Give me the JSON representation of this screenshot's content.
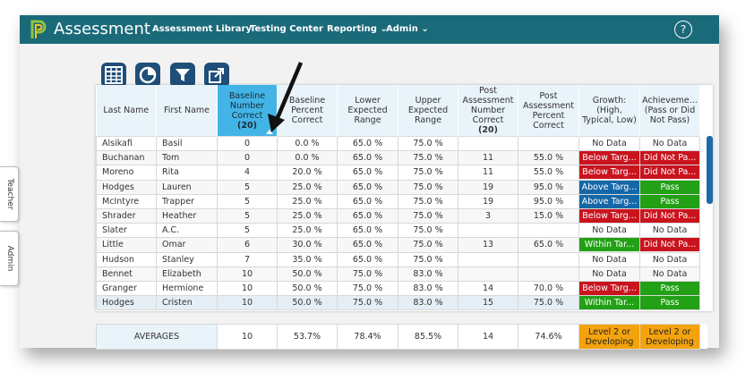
{
  "app": {
    "title": "Assessment",
    "nav": [
      {
        "label": "Assessment Library",
        "dropdown": false
      },
      {
        "label": "Testing Center",
        "dropdown": false
      },
      {
        "label": "Reporting",
        "dropdown": true
      },
      {
        "label": "Admin",
        "dropdown": true
      }
    ],
    "help_label": "?",
    "brand_color": "#1a6a7a"
  },
  "toolbar": {
    "icons": [
      "table-view-icon",
      "chart-view-icon",
      "filter-icon",
      "export-icon"
    ]
  },
  "side_tabs": [
    {
      "label": "Teacher"
    },
    {
      "label": "Admin"
    }
  ],
  "table": {
    "headers": [
      {
        "label": "Last Name",
        "count": ""
      },
      {
        "label": "First Name",
        "count": ""
      },
      {
        "label": "Baseline Number Correct",
        "count": "(20)",
        "selected": true
      },
      {
        "label": "Baseline Percent Correct",
        "count": ""
      },
      {
        "label": "Lower Expected Range",
        "count": ""
      },
      {
        "label": "Upper Expected Range",
        "count": ""
      },
      {
        "label": "Post Assessment Number Correct",
        "count": "(20)"
      },
      {
        "label": "Post Assessment Percent Correct",
        "count": ""
      },
      {
        "label": "Growth: (High, Typical, Low)",
        "count": ""
      },
      {
        "label": "Achieveme... (Pass or Did Not Pass)",
        "count": ""
      }
    ],
    "rows": [
      {
        "last": "Alsikafi",
        "first": "Basil",
        "bnc": "0",
        "bpc": "0.0 %",
        "low": "65.0 %",
        "up": "75.0 %",
        "pnc": "",
        "ppc": "",
        "growth": "No Data",
        "growth_color": "none",
        "ach": "No Data",
        "ach_color": "none"
      },
      {
        "last": "Buchanan",
        "first": "Tom",
        "bnc": "0",
        "bpc": "0.0 %",
        "low": "65.0 %",
        "up": "75.0 %",
        "pnc": "11",
        "ppc": "55.0 %",
        "growth": "Below Targ...",
        "growth_color": "red",
        "ach": "Did Not Pa...",
        "ach_color": "red"
      },
      {
        "last": "Moreno",
        "first": "Rita",
        "bnc": "4",
        "bpc": "20.0 %",
        "low": "65.0 %",
        "up": "75.0 %",
        "pnc": "11",
        "ppc": "55.0 %",
        "growth": "Below Targ...",
        "growth_color": "red",
        "ach": "Did Not Pa...",
        "ach_color": "red"
      },
      {
        "last": "Hodges",
        "first": "Lauren",
        "bnc": "5",
        "bpc": "25.0 %",
        "low": "65.0 %",
        "up": "75.0 %",
        "pnc": "19",
        "ppc": "95.0 %",
        "growth": "Above Targ...",
        "growth_color": "blue",
        "ach": "Pass",
        "ach_color": "green"
      },
      {
        "last": "McIntyre",
        "first": "Trapper",
        "bnc": "5",
        "bpc": "25.0 %",
        "low": "65.0 %",
        "up": "75.0 %",
        "pnc": "19",
        "ppc": "95.0 %",
        "growth": "Above Targ...",
        "growth_color": "blue",
        "ach": "Pass",
        "ach_color": "green"
      },
      {
        "last": "Shrader",
        "first": "Heather",
        "bnc": "5",
        "bpc": "25.0 %",
        "low": "65.0 %",
        "up": "75.0 %",
        "pnc": "3",
        "ppc": "15.0 %",
        "growth": "Below Targ...",
        "growth_color": "red",
        "ach": "Did Not Pa...",
        "ach_color": "red"
      },
      {
        "last": "Slater",
        "first": "A.C.",
        "bnc": "5",
        "bpc": "25.0 %",
        "low": "65.0 %",
        "up": "75.0 %",
        "pnc": "",
        "ppc": "",
        "growth": "No Data",
        "growth_color": "none",
        "ach": "No Data",
        "ach_color": "none"
      },
      {
        "last": "Little",
        "first": "Omar",
        "bnc": "6",
        "bpc": "30.0 %",
        "low": "65.0 %",
        "up": "75.0 %",
        "pnc": "13",
        "ppc": "65.0 %",
        "growth": "Within Tar...",
        "growth_color": "green",
        "ach": "Did Not Pa...",
        "ach_color": "red"
      },
      {
        "last": "Hudson",
        "first": "Stanley",
        "bnc": "7",
        "bpc": "35.0 %",
        "low": "65.0 %",
        "up": "75.0 %",
        "pnc": "",
        "ppc": "",
        "growth": "No Data",
        "growth_color": "none",
        "ach": "No Data",
        "ach_color": "none"
      },
      {
        "last": "Bennet",
        "first": "Elizabeth",
        "bnc": "10",
        "bpc": "50.0 %",
        "low": "75.0 %",
        "up": "83.0 %",
        "pnc": "",
        "ppc": "",
        "growth": "No Data",
        "growth_color": "none",
        "ach": "No Data",
        "ach_color": "none"
      },
      {
        "last": "Granger",
        "first": "Hermione",
        "bnc": "10",
        "bpc": "50.0 %",
        "low": "75.0 %",
        "up": "83.0 %",
        "pnc": "14",
        "ppc": "70.0 %",
        "growth": "Below Targ...",
        "growth_color": "red",
        "ach": "Pass",
        "ach_color": "green"
      },
      {
        "last": "Hodges",
        "first": "Cristen",
        "bnc": "10",
        "bpc": "50.0 %",
        "low": "75.0 %",
        "up": "83.0 %",
        "pnc": "15",
        "ppc": "75.0 %",
        "growth": "Within Tar...",
        "growth_color": "green",
        "ach": "Pass",
        "ach_color": "green"
      }
    ]
  },
  "averages": {
    "label": "AVERAGES",
    "bnc": "10",
    "bpc": "53.7%",
    "low": "78.4%",
    "up": "85.5%",
    "pnc": "14",
    "ppc": "74.6%",
    "growth": "Level 2 or Developing",
    "ach": "Level 2 or Developing"
  },
  "colors": {
    "red": "#c9141e",
    "blue": "#1568a8",
    "green": "#22a016",
    "orange": "#f5a30c",
    "selected_header": "#43b4e6"
  }
}
